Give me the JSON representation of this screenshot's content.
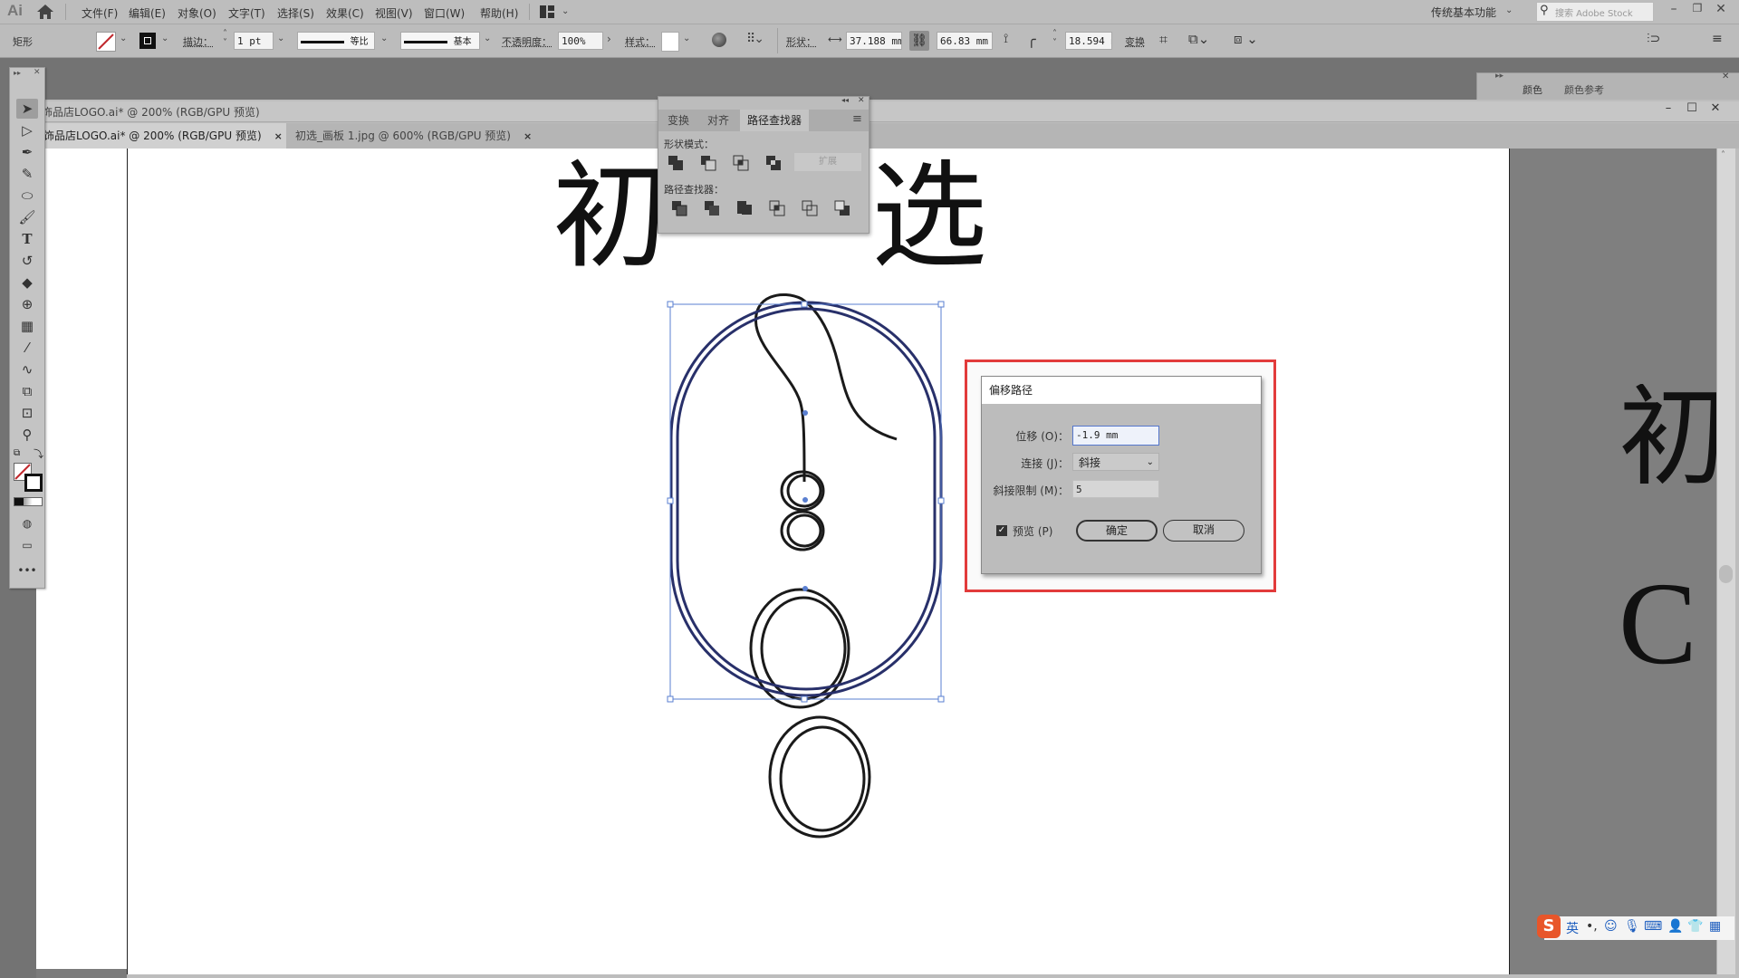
{
  "app": {
    "logo": "Ai"
  },
  "menu": {
    "items": [
      "文件(F)",
      "编辑(E)",
      "对象(O)",
      "文字(T)",
      "选择(S)",
      "效果(C)",
      "视图(V)",
      "窗口(W)",
      "帮助(H)"
    ],
    "workspace": "传统基本功能",
    "search_placeholder": "搜索 Adobe Stock"
  },
  "control_bar": {
    "object_type": "矩形",
    "stroke_label": "描边：",
    "stroke_weight": "1 pt",
    "profile_1": "等比",
    "profile_2": "基本",
    "opacity_label": "不透明度：",
    "opacity": "100%",
    "style_label": "样式：",
    "shape_label": "形状：",
    "width": "37.188 mm",
    "height": "66.83 mm",
    "corner": "18.594 m",
    "transform_label": "变换"
  },
  "document": {
    "title": "饰品店LOGO.ai* @ 200% (RGB/GPU 预览)",
    "tabs": [
      {
        "label": "饰品店LOGO.ai* @ 200% (RGB/GPU 预览)",
        "active": true
      },
      {
        "label": "初选_画板 1.jpg @ 600% (RGB/GPU 预览)",
        "active": false
      }
    ]
  },
  "canvas": {
    "char_1": "初",
    "char_2": "选",
    "right_char": "初",
    "right_latin": "C"
  },
  "pathfinder_panel": {
    "tabs": [
      "变换",
      "对齐",
      "路径查找器"
    ],
    "active_tab": "路径查找器",
    "shape_modes_label": "形状模式：",
    "expand_label": "扩展",
    "pathfinders_label": "路径查找器："
  },
  "color_panel": {
    "tabs": [
      "颜色",
      "颜色参考"
    ]
  },
  "offset_dialog": {
    "title": "偏移路径",
    "offset_label": "位移 (O)：",
    "offset_value": "-1.9 mm",
    "joins_label": "连接 (J)：",
    "joins_value": "斜接",
    "miter_label": "斜接限制 (M)：",
    "miter_value": "5",
    "preview_label": "预览 (P)",
    "preview_checked": true,
    "ok_label": "确定",
    "cancel_label": "取消"
  },
  "ime": {
    "items": [
      "英",
      "°,",
      "☺",
      "mic",
      "keyboard",
      "user",
      "shirt",
      "grid"
    ]
  },
  "colors": {
    "selection": "#3d5aa8",
    "highlight_box": "#e23b3b"
  }
}
